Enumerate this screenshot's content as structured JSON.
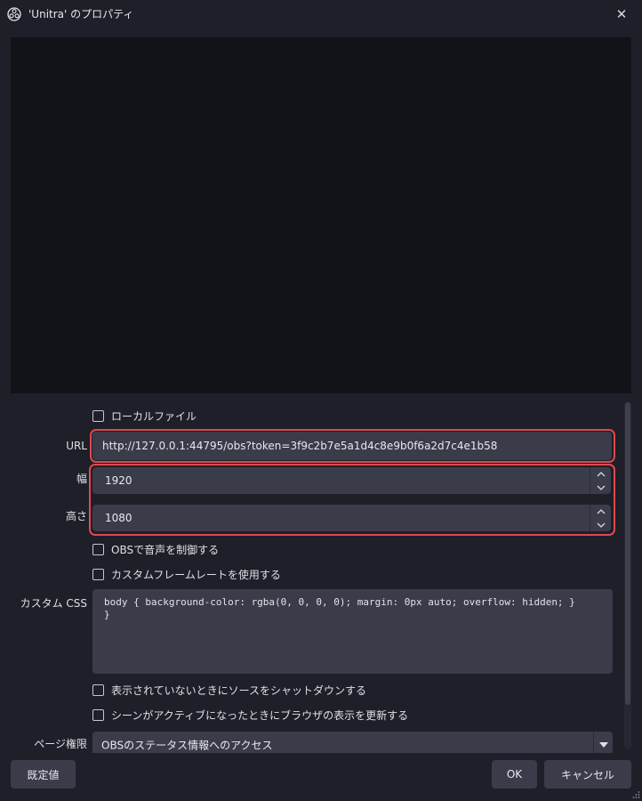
{
  "window": {
    "title": "'Unitra' のプロパティ",
    "close_glyph": "✕"
  },
  "form": {
    "local_file_label": "ローカルファイル",
    "url_label": "URL",
    "url_value": "http://127.0.0.1:44795/obs?token=3f9c2b7e5a1d4c8e9b0f6a2d7c4e1b58",
    "width_label": "幅",
    "width_value": "1920",
    "height_label": "高さ",
    "height_value": "1080",
    "obs_audio_label": "OBSで音声を制御する",
    "custom_fps_label": "カスタムフレームレートを使用する",
    "css_label": "カスタム CSS",
    "css_value": "body { background-color: rgba(0, 0, 0, 0); margin: 0px auto; overflow: hidden; }\n}",
    "shutdown_label": "表示されていないときにソースをシャットダウンする",
    "refresh_label": "シーンがアクティブになったときにブラウザの表示を更新する",
    "page_permissions_label": "ページ権限",
    "page_permissions_value": "OBSのステータス情報へのアクセス"
  },
  "buttons": {
    "defaults": "既定値",
    "ok": "OK",
    "cancel": "キャンセル"
  },
  "icons": {
    "app": "obs-logo-icon",
    "spin_up": "chevron-up-icon",
    "spin_down": "chevron-down-icon",
    "dropdown": "triangle-down-icon"
  },
  "colors": {
    "highlight": "#e0484f",
    "background": "#1e1f28",
    "field": "#3a3c4a"
  }
}
